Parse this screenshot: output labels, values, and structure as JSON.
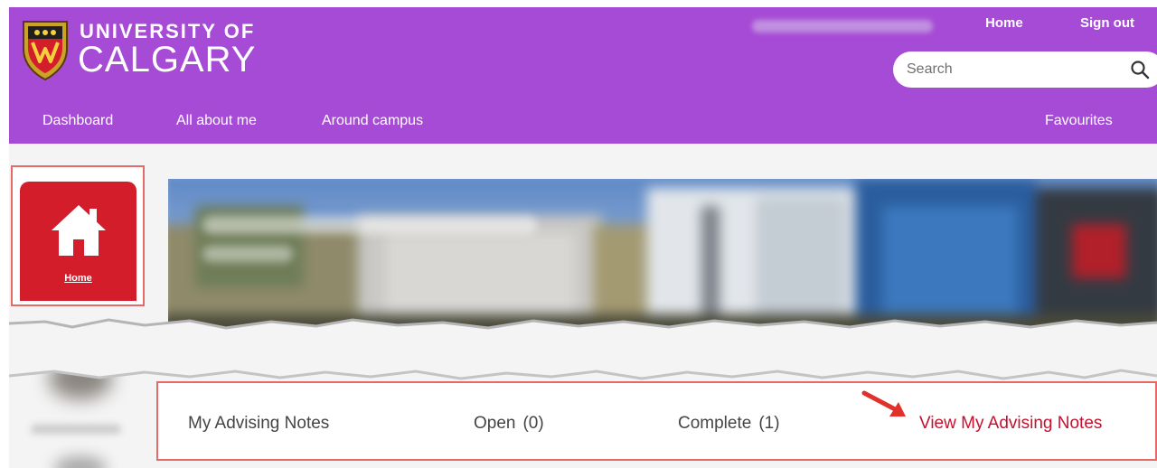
{
  "header": {
    "brand_line1": "UNIVERSITY OF",
    "brand_line2": "CALGARY",
    "top_links": {
      "home": "Home",
      "sign_out": "Sign out"
    },
    "search_placeholder": "Search",
    "nav": {
      "dashboard": "Dashboard",
      "all_about_me": "All about me",
      "around_campus": "Around campus",
      "favourites": "Favourites"
    }
  },
  "sidebar": {
    "home_label": "Home"
  },
  "advising": {
    "title": "My Advising Notes",
    "open_label": "Open",
    "open_count": "(0)",
    "complete_label": "Complete",
    "complete_count": "(1)",
    "view_link": "View My Advising Notes"
  },
  "colors": {
    "header_bg": "#a64bd6",
    "home_tile": "#d41d2b",
    "link_red": "#c8102e",
    "highlight_border": "#e46a6a",
    "annotation_arrow": "#e0312b"
  },
  "icons": {
    "crest": "university-crest-icon",
    "search": "search-icon",
    "home": "home-icon",
    "annotation": "annotation-arrow-icon"
  }
}
